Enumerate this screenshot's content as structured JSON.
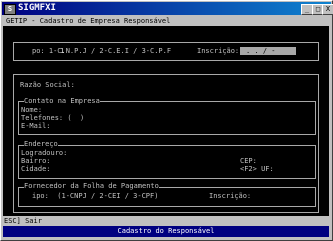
{
  "window": {
    "title": "SIGMFXI",
    "icon_label": "S",
    "btn_minimize": "_",
    "btn_maximize": "□",
    "btn_close": "X"
  },
  "toolbar": {
    "text": "GETIP - Cadastro de Empresa Responsável"
  },
  "form": {
    "tipo_label": "po: 1-C.N.P.J / 2-C.E.I / 3-C.P.F",
    "tipo_value": "1",
    "inscricao_label": "Inscrição:",
    "inscricao_value": ".  .  /  -",
    "razao_social_label": "Razão Social:",
    "contato_section": "Contato na Empresa",
    "nome_label": "Nome:",
    "telefones_label": "Telefones: (  )",
    "email_label": "E-Mail:",
    "endereco_section": "Endereço",
    "logradouro_label": "Logradouro:",
    "bairro_label": "Bairro:",
    "cidade_label": "Cidade:",
    "cep_label": "CEP:",
    "uf_label": "<F2> UF:",
    "fornecedor_section": "Fornecedor da Folha de Pagamento",
    "fornecedor_tipo_label": "ipo:  (1-CNPJ / 2-CEI / 3-CPF)",
    "fornecedor_inscricao_label": "Inscrição:"
  },
  "status": {
    "hint": "ESC] Sair",
    "title": "Cadastro do Responsável"
  }
}
